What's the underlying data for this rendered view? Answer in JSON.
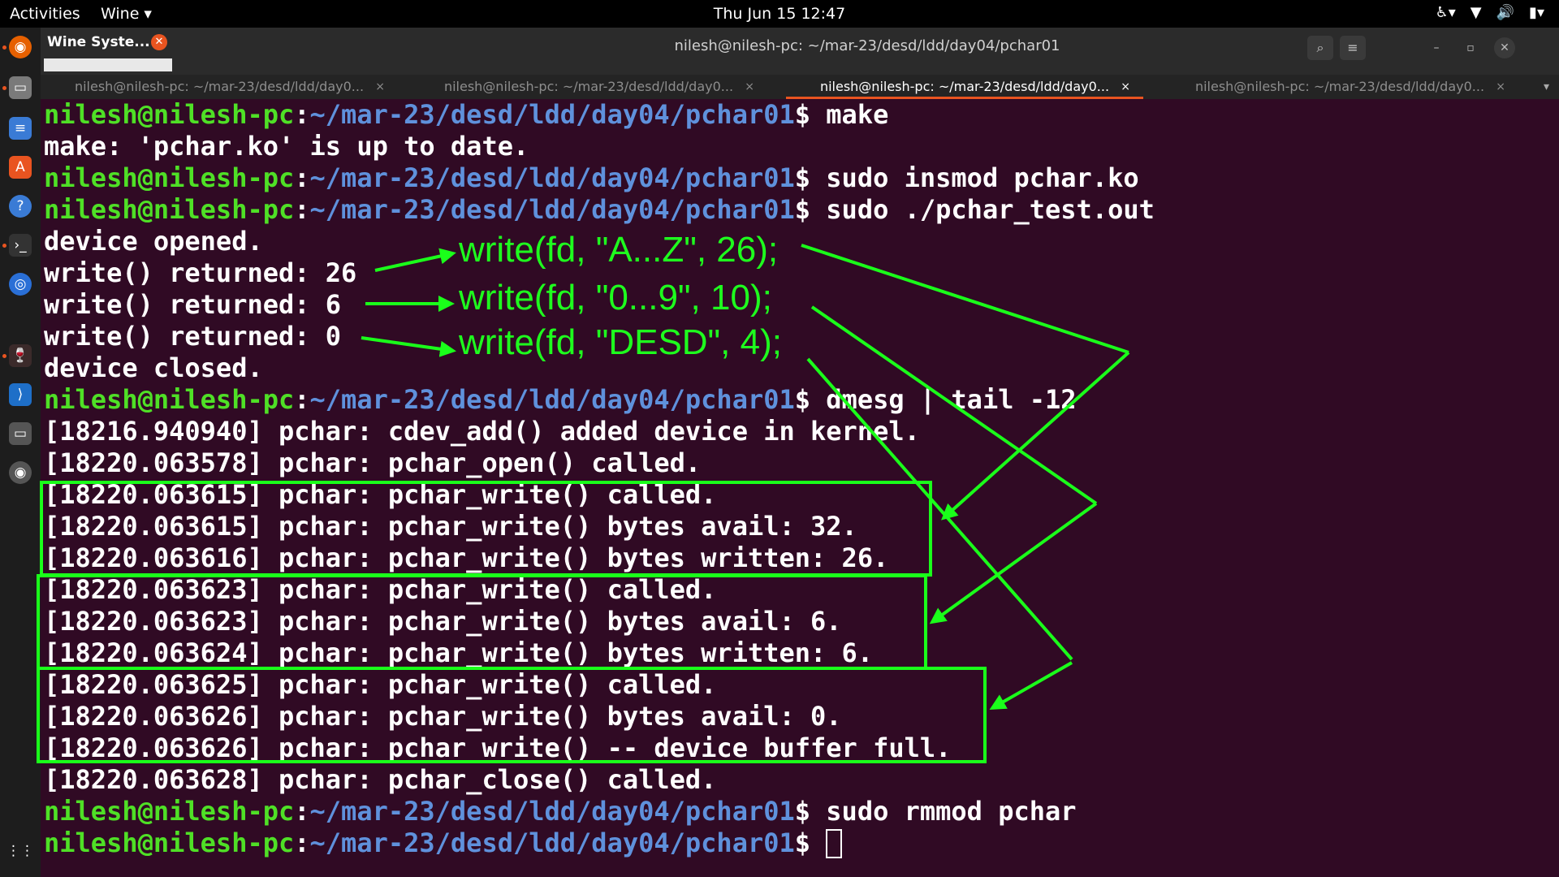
{
  "topbar": {
    "activities": "Activities",
    "app_menu": "Wine ▾",
    "clock": "Thu Jun 15  12:47"
  },
  "wine_window": {
    "title": "Wine Syste...",
    "close": "✕"
  },
  "window": {
    "title": "nilesh@nilesh-pc: ~/mar-23/desd/ldd/day04/pchar01"
  },
  "tabs": [
    {
      "label": "nilesh@nilesh-pc: ~/mar-23/desd/ldd/day0..."
    },
    {
      "label": "nilesh@nilesh-pc: ~/mar-23/desd/ldd/day0..."
    },
    {
      "label": "nilesh@nilesh-pc: ~/mar-23/desd/ldd/day0..."
    },
    {
      "label": "nilesh@nilesh-pc: ~/mar-23/desd/ldd/day0..."
    }
  ],
  "prompt": {
    "user": "nilesh@nilesh-pc",
    "sep": ":",
    "path": "~/mar-23/desd/ldd/day04/pchar01",
    "dollar": "$ "
  },
  "terminal": {
    "cmd1": "make",
    "out1": "make: 'pchar.ko' is up to date.",
    "cmd2": "sudo insmod pchar.ko",
    "cmd3": "sudo ./pchar_test.out",
    "out2": "device opened.",
    "out3": "write() returned: 26",
    "out4": "write() returned: 6",
    "out5": "write() returned: 0",
    "out6": "device closed.",
    "cmd4": "dmesg | tail -12",
    "log1": "[18216.940940] pchar: cdev_add() added device in kernel.",
    "log2": "[18220.063578] pchar: pchar_open() called.",
    "log3": "[18220.063615] pchar: pchar_write() called.",
    "log4": "[18220.063615] pchar: pchar_write() bytes avail: 32.",
    "log5": "[18220.063616] pchar: pchar_write() bytes written: 26.",
    "log6": "[18220.063623] pchar: pchar_write() called.",
    "log7": "[18220.063623] pchar: pchar_write() bytes avail: 6.",
    "log8": "[18220.063624] pchar: pchar_write() bytes written: 6.",
    "log9": "[18220.063625] pchar: pchar_write() called.",
    "log10": "[18220.063626] pchar: pchar_write() bytes avail: 0.",
    "log11": "[18220.063626] pchar: pchar_write() -- device buffer full.",
    "log12": "[18220.063628] pchar: pchar_close() called.",
    "cmd5": "sudo rmmod pchar"
  },
  "annotations": {
    "a1": "write(fd, \"A...Z\", 26);",
    "a2": "write(fd, \"0...9\", 10);",
    "a3": "write(fd, \"DESD\", 4);"
  },
  "colors": {
    "terminal_bg": "#300a24",
    "prompt_user": "#4fe026",
    "prompt_path": "#5f91dc",
    "annotation": "#1eff1e",
    "accent": "#e95420"
  }
}
